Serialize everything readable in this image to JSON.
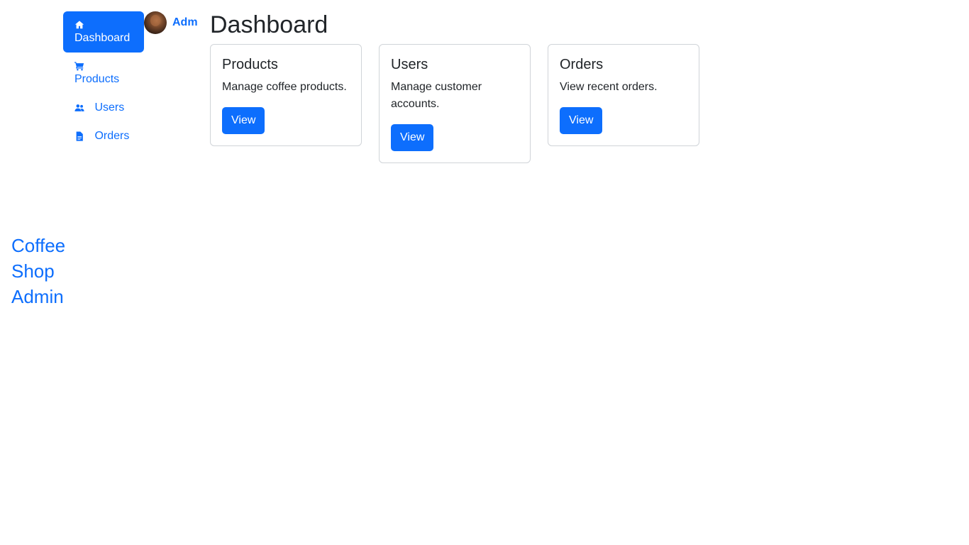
{
  "brand": {
    "lines": [
      "Coffee",
      "Shop",
      "Admin"
    ]
  },
  "nav": {
    "items": [
      {
        "label": "Dashboard",
        "icon": "home-icon",
        "active": true
      },
      {
        "label": "Products",
        "icon": "cart-icon",
        "active": false
      },
      {
        "label": "Users",
        "icon": "users-icon",
        "active": false
      },
      {
        "label": "Orders",
        "icon": "document-icon",
        "active": false
      }
    ]
  },
  "user": {
    "name": "Adm"
  },
  "main": {
    "title": "Dashboard",
    "cards": [
      {
        "title": "Products",
        "text": "Manage coffee products.",
        "button": "View"
      },
      {
        "title": "Users",
        "text": "Manage customer accounts.",
        "button": "View"
      },
      {
        "title": "Orders",
        "text": "View recent orders.",
        "button": "View"
      }
    ]
  },
  "colors": {
    "primary": "#0d6efd",
    "text": "#212529",
    "card_border": "#d0d4d8"
  }
}
